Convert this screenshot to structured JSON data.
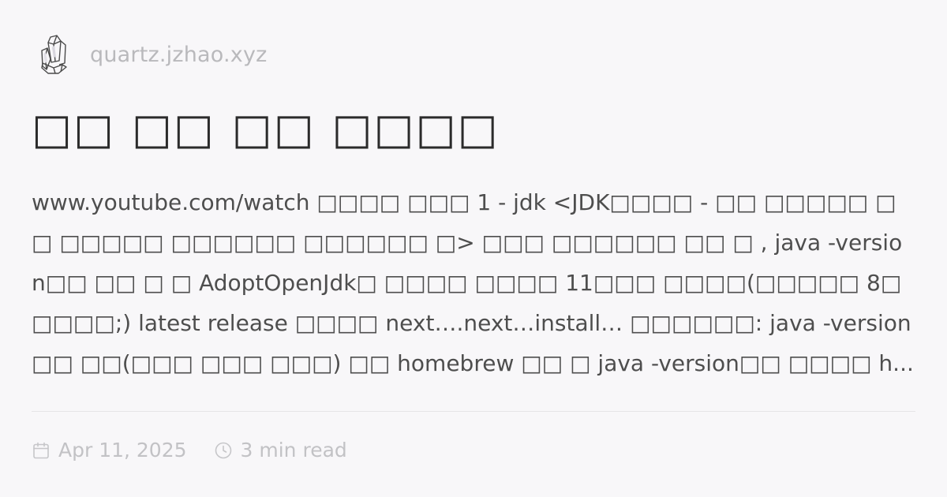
{
  "site": {
    "domain": "quartz.jzhao.xyz",
    "logo_icon": "crystal-cluster-icon"
  },
  "article": {
    "title": "□□ □□ □□ □□□□",
    "description": "www.youtube.com/watch □□□□ □□□ 1 - jdk <JDK□□□□ - □□ □□□□□ □□ □□□□□ □□□□□□ □□□□□□ □> □□□ □□□□□□ □□ □ , java -version□□ □□ □ □ AdoptOpenJdk□ □□□□ □□□□ 11□□□ □□□□(□□□□□ 8□□□□□;) latest release □□□□ next….next…install… □□□□□□: java -version □□ □□(□□□ □□□ □□□) □□ homebrew □□ □ java -version□□ □□□□ h...",
    "date": "Apr 11, 2025",
    "read_time": "3 min read"
  },
  "icons": {
    "date": "calendar-icon",
    "read_time": "clock-icon"
  },
  "colors": {
    "background": "#f8f7f9",
    "title": "#2b2b2b",
    "body_text": "#4e4e4e",
    "muted": "#c2c2c5",
    "divider": "#e6e5e7"
  }
}
